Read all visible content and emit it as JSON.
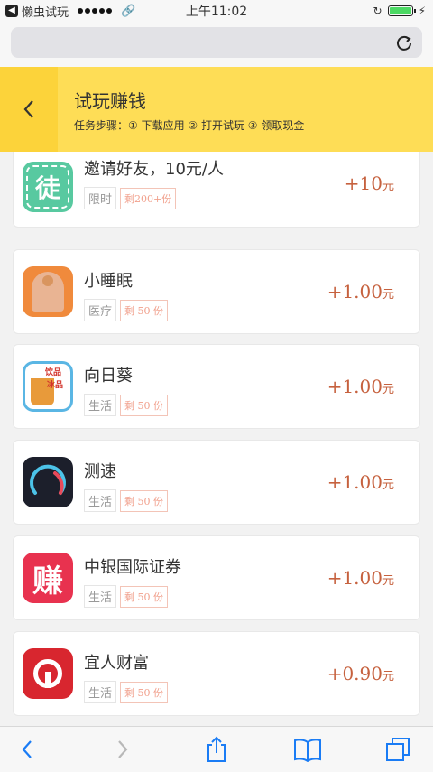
{
  "status_bar": {
    "app_back_label": "懒虫试玩",
    "time": "上午11:02"
  },
  "header": {
    "title": "试玩赚钱",
    "steps": "任务步骤：① 下载应用 ② 打开试玩 ③ 领取现金"
  },
  "tasks": [
    {
      "name": "邀请好友，10元/人",
      "category": "限时",
      "remaining": "剩200+份",
      "reward": "+10",
      "unit": "元",
      "icon": "invite-tu-icon"
    },
    {
      "name": "小睡眠",
      "category": "医疗",
      "remaining": "剩 50 份",
      "reward": "+1.00",
      "unit": "元",
      "icon": "sleep-app-icon"
    },
    {
      "name": "向日葵",
      "category": "生活",
      "remaining": "剩 50 份",
      "reward": "+1.00",
      "unit": "元",
      "icon": "drink-app-icon"
    },
    {
      "name": "测速",
      "category": "生活",
      "remaining": "剩 50 份",
      "reward": "+1.00",
      "unit": "元",
      "icon": "speedometer-icon"
    },
    {
      "name": "中银国际证券",
      "category": "生活",
      "remaining": "剩 50 份",
      "reward": "+1.00",
      "unit": "元",
      "icon": "zhuan-app-icon"
    },
    {
      "name": "宜人财富",
      "category": "生活",
      "remaining": "剩 50 份",
      "reward": "+0.90",
      "unit": "元",
      "icon": "yiren-app-icon"
    }
  ],
  "icon_text": {
    "invite": "徒",
    "zhuan": "赚",
    "drink_line1": "饮品",
    "drink_line2": "冰品"
  },
  "colors": {
    "header_bg": "#fedd56",
    "reward": "#c6613e",
    "tag_border": "#f3c4b7"
  }
}
